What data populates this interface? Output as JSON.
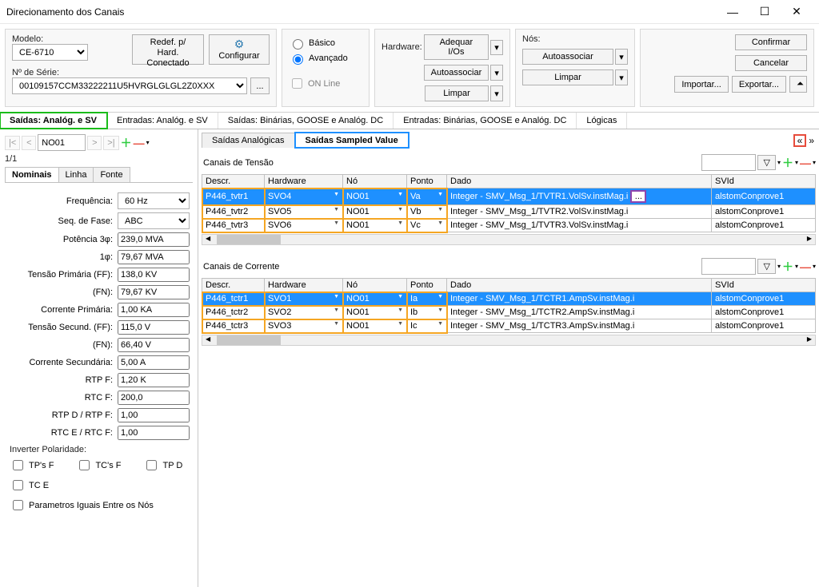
{
  "window": {
    "title": "Direcionamento dos Canais"
  },
  "top": {
    "model_label": "Modelo:",
    "model": "CE-6710",
    "serial_label": "Nº de Série:",
    "serial": "00109157CCM33222211U5HVRGLGLGL2Z0XXX",
    "redef_btn": "Redef. p/ Hard. Conectado",
    "config_btn": "Configurar",
    "radio_basic": "Básico",
    "radio_adv": "Avançado",
    "online": "ON Line",
    "hardware_label": "Hardware:",
    "hw_adequar": "Adequar I/Os",
    "hw_auto": "Autoassociar",
    "hw_limpar": "Limpar",
    "nos_label": "Nós:",
    "confirm": "Confirmar",
    "cancel": "Cancelar",
    "import": "Importar...",
    "export": "Exportar...",
    "more_btn": "..."
  },
  "maintabs": {
    "t1": "Saídas: Analóg. e SV",
    "t2": "Entradas: Analóg. e SV",
    "t3": "Saídas: Binárias, GOOSE e Analóg. DC",
    "t4": "Entradas: Binárias, GOOSE e Analóg. DC",
    "t5": "Lógicas"
  },
  "nodebar": {
    "value": "NO01",
    "counter": "1/1"
  },
  "left_subtabs": {
    "t1": "Nominais",
    "t2": "Linha",
    "t3": "Fonte"
  },
  "form": {
    "freq_l": "Frequência:",
    "freq_v": "60 Hz",
    "seq_l": "Seq. de Fase:",
    "seq_v": "ABC",
    "pot3_l": "Potência 3φ:",
    "pot3_v": "239,0 MVA",
    "pot1_l": "1φ:",
    "pot1_v": "79,67 MVA",
    "tpff_l": "Tensão Primária (FF):",
    "tpff_v": "138,0 KV",
    "tpfn_l": "(FN):",
    "tpfn_v": "79,67 KV",
    "cp_l": "Corrente Primária:",
    "cp_v": "1,00 KA",
    "tsff_l": "Tensão Secund. (FF):",
    "tsff_v": "115,0 V",
    "tsfn_l": "(FN):",
    "tsfn_v": "66,40 V",
    "cs_l": "Corrente Secundária:",
    "cs_v": "5,00 A",
    "rtpf_l": "RTP F:",
    "rtpf_v": "1,20 K",
    "rtcf_l": "RTC F:",
    "rtcf_v": "200,0",
    "rtpd_l": "RTP D / RTP F:",
    "rtpd_v": "1,00",
    "rtce_l": "RTC E / RTC F:",
    "rtce_v": "1,00",
    "inv_pol": "Inverter Polaridade:",
    "tps_f": "TP's F",
    "tcs_f": "TC's F",
    "tp_d": "TP D",
    "tc_e": "TC E",
    "param_iguais": "Parametros Iguais Entre os Nós"
  },
  "svtabs": {
    "t1": "Saídas Analógicas",
    "t2": "Saídas Sampled Value"
  },
  "grid_hdrs": {
    "tensao": "Canais de Tensão",
    "corrente": "Canais de Corrente",
    "descr": "Descr.",
    "hw": "Hardware",
    "no": "Nó",
    "ponto": "Ponto",
    "dado": "Dado",
    "svid": "SVId"
  },
  "tensao_rows": [
    {
      "descr": "P446_tvtr1",
      "hw": "SVO4",
      "no": "NO01",
      "ponto": "Va",
      "dado": "Integer - SMV_Msg_1/TVTR1.VolSv.instMag.i",
      "svid": "alstomConprove1",
      "sel": true,
      "ell": true
    },
    {
      "descr": "P446_tvtr2",
      "hw": "SVO5",
      "no": "NO01",
      "ponto": "Vb",
      "dado": "Integer - SMV_Msg_1/TVTR2.VolSv.instMag.i",
      "svid": "alstomConprove1"
    },
    {
      "descr": "P446_tvtr3",
      "hw": "SVO6",
      "no": "NO01",
      "ponto": "Vc",
      "dado": "Integer - SMV_Msg_1/TVTR3.VolSv.instMag.i",
      "svid": "alstomConprove1"
    }
  ],
  "corrente_rows": [
    {
      "descr": "P446_tctr1",
      "hw": "SVO1",
      "no": "NO01",
      "ponto": "Ia",
      "dado": "Integer - SMV_Msg_1/TCTR1.AmpSv.instMag.i",
      "svid": "alstomConprove1",
      "sel": true
    },
    {
      "descr": "P446_tctr2",
      "hw": "SVO2",
      "no": "NO01",
      "ponto": "Ib",
      "dado": "Integer - SMV_Msg_1/TCTR2.AmpSv.instMag.i",
      "svid": "alstomConprove1"
    },
    {
      "descr": "P446_tctr3",
      "hw": "SVO3",
      "no": "NO01",
      "ponto": "Ic",
      "dado": "Integer - SMV_Msg_1/TCTR3.AmpSv.instMag.i",
      "svid": "alstomConprove1"
    }
  ]
}
